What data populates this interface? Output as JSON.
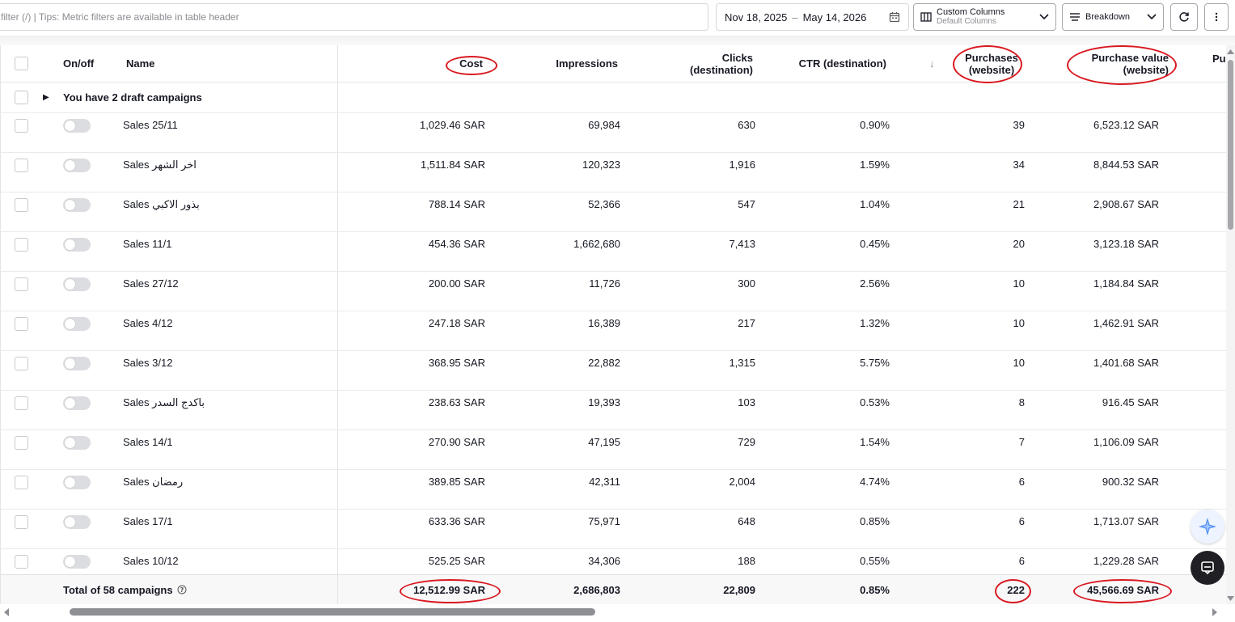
{
  "toolbar": {
    "filter_placeholder": "filter (/) | Tips: Metric filters are available in table header",
    "date_start": "Nov 18, 2025",
    "date_sep": "–",
    "date_end": "May 14, 2026",
    "custom_columns_label": "Custom Columns",
    "custom_columns_sub": "Default Columns",
    "breakdown_label": "Breakdown"
  },
  "columns": {
    "onoff": "On/off",
    "name": "Name",
    "cost": "Cost",
    "impressions": "Impressions",
    "clicks_l1": "Clicks",
    "clicks_l2": "(destination)",
    "ctr": "CTR (destination)",
    "sort_arrow": "↓",
    "purchases_l1": "Purchases",
    "purchases_l2": "(website)",
    "purchase_value_l1": "Purchase value",
    "purchase_value_l2": "(website)",
    "more": "Pu"
  },
  "draft_row": {
    "label": "You have 2 draft campaigns"
  },
  "rows": [
    {
      "name": "Sales 25/11",
      "cost": "1,029.46 SAR",
      "impressions": "69,984",
      "clicks": "630",
      "ctr": "0.90%",
      "purchases": "39",
      "value": "6,523.12 SAR"
    },
    {
      "name": "Sales اخر الشهر",
      "cost": "1,511.84 SAR",
      "impressions": "120,323",
      "clicks": "1,916",
      "ctr": "1.59%",
      "purchases": "34",
      "value": "8,844.53 SAR"
    },
    {
      "name": "Sales بذور الاكبي",
      "cost": "788.14 SAR",
      "impressions": "52,366",
      "clicks": "547",
      "ctr": "1.04%",
      "purchases": "21",
      "value": "2,908.67 SAR"
    },
    {
      "name": "Sales 11/1",
      "cost": "454.36 SAR",
      "impressions": "1,662,680",
      "clicks": "7,413",
      "ctr": "0.45%",
      "purchases": "20",
      "value": "3,123.18 SAR"
    },
    {
      "name": "Sales 27/12",
      "cost": "200.00 SAR",
      "impressions": "11,726",
      "clicks": "300",
      "ctr": "2.56%",
      "purchases": "10",
      "value": "1,184.84 SAR"
    },
    {
      "name": "Sales 4/12",
      "cost": "247.18 SAR",
      "impressions": "16,389",
      "clicks": "217",
      "ctr": "1.32%",
      "purchases": "10",
      "value": "1,462.91 SAR"
    },
    {
      "name": "Sales 3/12",
      "cost": "368.95 SAR",
      "impressions": "22,882",
      "clicks": "1,315",
      "ctr": "5.75%",
      "purchases": "10",
      "value": "1,401.68 SAR"
    },
    {
      "name": "Sales باكدج السدر",
      "cost": "238.63 SAR",
      "impressions": "19,393",
      "clicks": "103",
      "ctr": "0.53%",
      "purchases": "8",
      "value": "916.45 SAR"
    },
    {
      "name": "Sales 14/1",
      "cost": "270.90 SAR",
      "impressions": "47,195",
      "clicks": "729",
      "ctr": "1.54%",
      "purchases": "7",
      "value": "1,106.09 SAR"
    },
    {
      "name": "Sales رمضان",
      "cost": "389.85 SAR",
      "impressions": "42,311",
      "clicks": "2,004",
      "ctr": "4.74%",
      "purchases": "6",
      "value": "900.32 SAR"
    },
    {
      "name": "Sales 17/1",
      "cost": "633.36 SAR",
      "impressions": "75,971",
      "clicks": "648",
      "ctr": "0.85%",
      "purchases": "6",
      "value": "1,713.07 SAR"
    },
    {
      "name": "Sales 10/12",
      "cost": "525.25 SAR",
      "impressions": "34,306",
      "clicks": "188",
      "ctr": "0.55%",
      "purchases": "6",
      "value": "1,229.28 SAR"
    }
  ],
  "total": {
    "label": "Total of 58 campaigns",
    "cost": "12,512.99 SAR",
    "impressions": "2,686,803",
    "clicks": "22,809",
    "ctr": "0.85%",
    "purchases": "222",
    "value": "45,566.69 SAR"
  },
  "colors": {
    "annotation": "#d9181f",
    "text": "#161823",
    "muted": "#8a8b91"
  }
}
